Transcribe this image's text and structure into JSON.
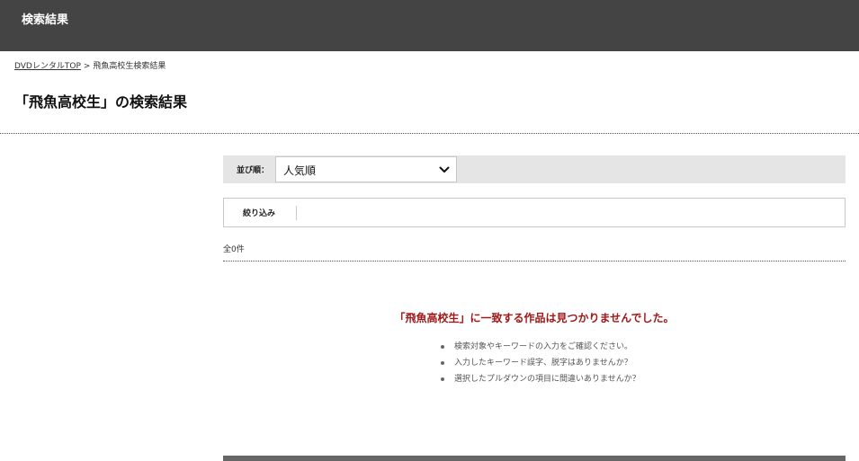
{
  "header": {
    "title": "検索結果"
  },
  "breadcrumb": {
    "home_label": "DVDレンタルTOP",
    "separator": ">",
    "current_label": "飛魚高校生検索結果"
  },
  "page": {
    "title": "「飛魚高校生」の検索結果"
  },
  "sort": {
    "label": "並び順：",
    "selected": "人気順"
  },
  "filter": {
    "label": "絞り込み"
  },
  "results": {
    "count_text": "全0件",
    "no_result_message": "「飛魚高校生」に一致する作品は見つかりませんでした。",
    "hints": [
      "検索対象やキーワードの入力をご確認ください。",
      "入力したキーワード誤字、脱字はありませんか？",
      "選択したプルダウンの項目に間違いありませんか？"
    ]
  },
  "colors": {
    "header_bg": "#444444",
    "accent_red": "#a01818",
    "sort_bar_bg": "#e5e5e5"
  },
  "icons": {
    "sort_chevron": "chevron-down-icon"
  }
}
